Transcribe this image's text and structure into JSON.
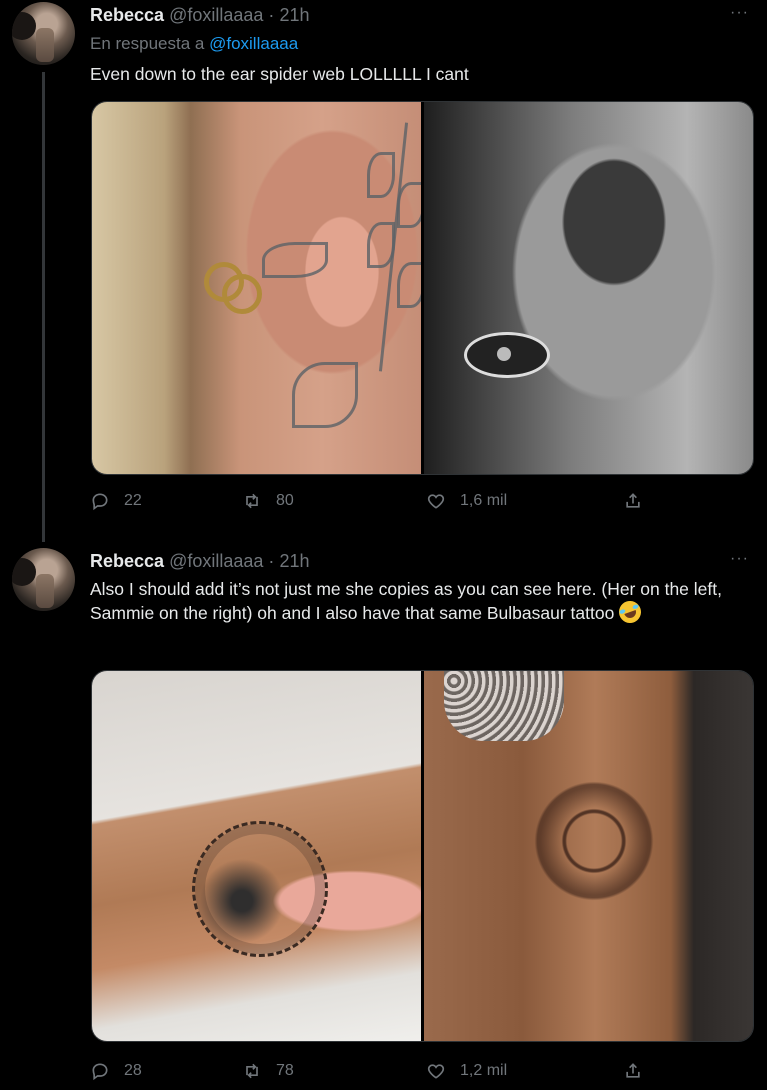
{
  "tweets": [
    {
      "author": "Rebecca",
      "handle": "@foxillaaaa",
      "time": "21h",
      "reply_prefix": "En respuesta a",
      "reply_to": "@foxillaaaa",
      "text": "Even down to the ear spider web LOLLLLL I cant",
      "stats": {
        "replies": "22",
        "retweets": "80",
        "likes": "1,6 mil"
      }
    },
    {
      "author": "Rebecca",
      "handle": "@foxillaaaa",
      "time": "21h",
      "text": "Also I should add it’s not just me she copies as you can see here. (Her on the left, Sammie on the right) oh and I also have that same Bulbasaur tattoo",
      "emoji": "rolling-on-floor-laughing-emoji",
      "stats": {
        "replies": "28",
        "retweets": "78",
        "likes": "1,2 mil"
      }
    }
  ],
  "ui": {
    "more": "···",
    "separator": "·"
  },
  "colors": {
    "background": "#000000",
    "text": "#e7e9ea",
    "muted": "#71767b",
    "link": "#1d9bf0"
  }
}
